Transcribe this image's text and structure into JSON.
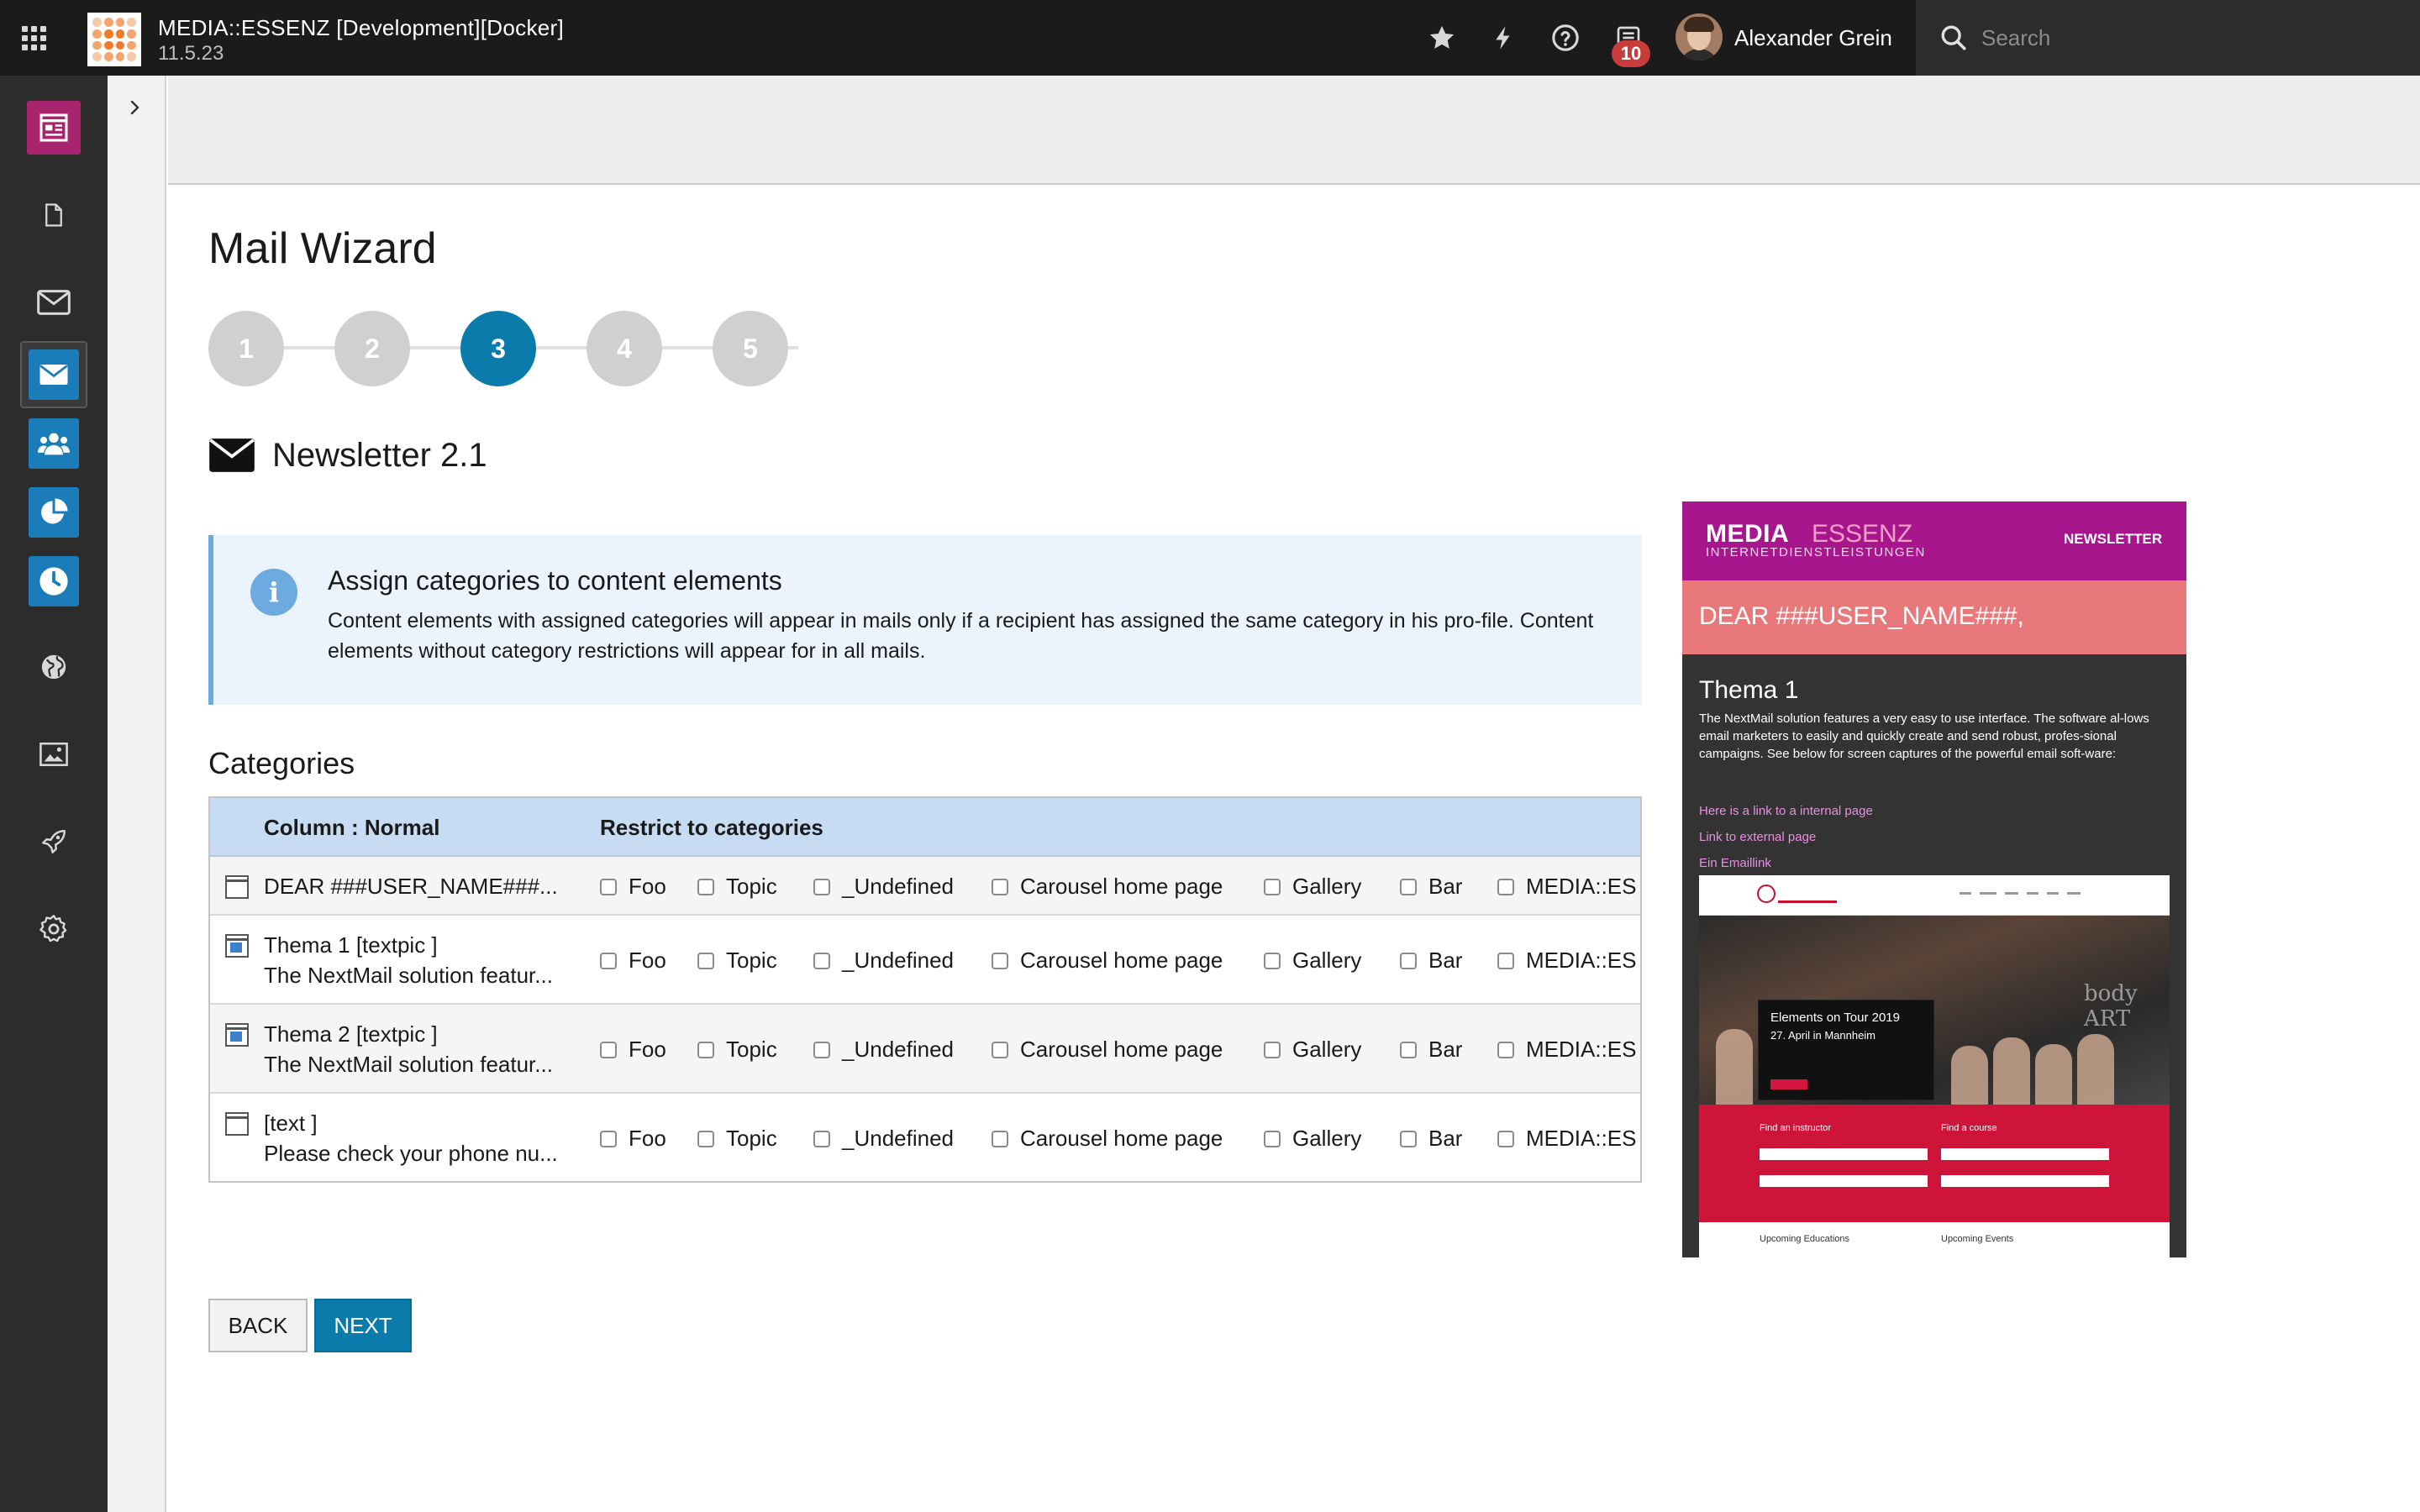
{
  "topbar": {
    "site_title": "MEDIA::ESSENZ [Development][Docker]",
    "version": "11.5.23",
    "notification_count": "10",
    "user_name": "Alexander Grein",
    "search_placeholder": "Search",
    "icons": [
      "app-grid-icon",
      "star-icon",
      "bolt-icon",
      "help-icon",
      "task-list-icon",
      "search-icon"
    ]
  },
  "modules": [
    "web-layout-icon",
    "page-icon",
    "mail-icon",
    "mail-filled-icon",
    "users-icon",
    "pie-chart-icon",
    "clock-icon",
    "globe-icon",
    "image-icon",
    "rocket-icon",
    "gear-icon"
  ],
  "page": {
    "title": "Mail Wizard",
    "steps": [
      "1",
      "2",
      "3",
      "4",
      "5"
    ],
    "active_step": 3,
    "newsletter_title": "Newsletter 2.1"
  },
  "callout": {
    "title": "Assign categories to content elements",
    "text": "Content elements with assigned categories will appear in mails only if a recipient has assigned the same category in his pro-file. Content elements without category restrictions will appear for in all mails."
  },
  "categories": {
    "heading": "Categories",
    "col_content": "Column : Normal",
    "col_restrict": "Restrict to categories",
    "options": [
      "Foo",
      "Topic",
      "_Undefined",
      "Carousel home page",
      "Gallery",
      "Bar",
      "MEDIA::ES"
    ],
    "rows": [
      {
        "title": "DEAR ###USER_NAME###...",
        "subtitle": ""
      },
      {
        "title": "Thema 1 [textpic ]",
        "subtitle": "The NextMail solution featur..."
      },
      {
        "title": "Thema 2 [textpic ]",
        "subtitle": "The NextMail solution featur..."
      },
      {
        "title": "[text ]",
        "subtitle": "Please check your phone nu..."
      }
    ]
  },
  "buttons": {
    "back": "BACK",
    "next": "NEXT"
  },
  "preview": {
    "brand_a": "MEDIA",
    "brand_b": "ESSENZ",
    "brand_sub": "INTERNETDIENSTLEISTUNGEN",
    "newsletter_label": "NEWSLETTER",
    "dear": "DEAR ###USER_NAME###,",
    "thema": "Thema 1",
    "text": "The NextMail solution features a very easy to use interface. The software al-lows email marketers to easily and quickly create and send robust, profes-sional campaigns. See below for screen captures of the powerful email soft-ware:",
    "links": [
      "Here is a link to a internal page",
      "Link to external page",
      "Ein Emaillink"
    ],
    "event_title": "Elements on Tour 2019",
    "event_date": "27. April in Mannheim",
    "body_art": "body ART",
    "find_instructor": "Find an instructor",
    "find_course": "Find a course",
    "upcoming_educations": "Upcoming Educations",
    "upcoming_events": "Upcoming Events"
  }
}
